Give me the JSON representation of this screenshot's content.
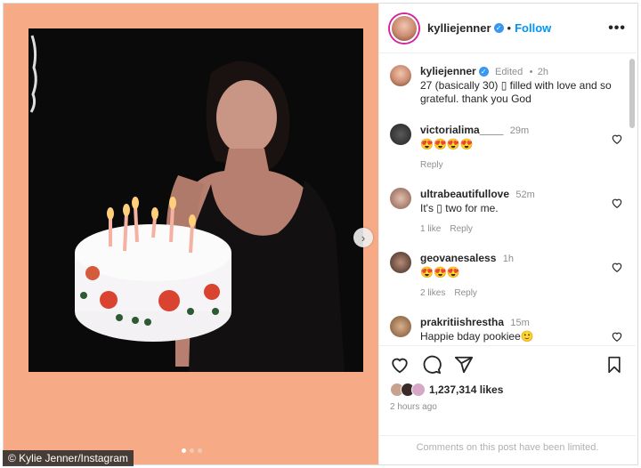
{
  "credit": "© Kylie Jenner/Instagram",
  "post": {
    "username": "kylliejenner",
    "follow_label": "Follow",
    "more_label": "•••",
    "caption": {
      "username": "kyliejenner",
      "edited": "Edited",
      "time": "2h",
      "text": "27 (basically 30) ▯ filled with love and so grateful. thank you God"
    },
    "media": {
      "slide_count": 3,
      "active_slide": 1
    }
  },
  "comments": [
    {
      "username": "victorialima____",
      "time": "29m",
      "text": "😍😍😍😍",
      "likes": "",
      "reply": "Reply"
    },
    {
      "username": "ultrabeautifullove",
      "time": "52m",
      "text": "It's ▯ two for me.",
      "likes": "1 like",
      "reply": "Reply"
    },
    {
      "username": "geovanesaless",
      "time": "1h",
      "text": "😍😍😍",
      "likes": "2 likes",
      "reply": "Reply"
    },
    {
      "username": "prakritiishrestha",
      "time": "15m",
      "text": "Happie bday pookiee🙂",
      "likes": "",
      "reply": ""
    }
  ],
  "likes_count": "1,237,314 likes",
  "posted_ago": "2 hours ago",
  "comments_limited": "Comments on this post have been limited.",
  "colors": {
    "accent": "#0095f6",
    "background_peach": "#f6ab86",
    "verified": "#3897f0"
  }
}
